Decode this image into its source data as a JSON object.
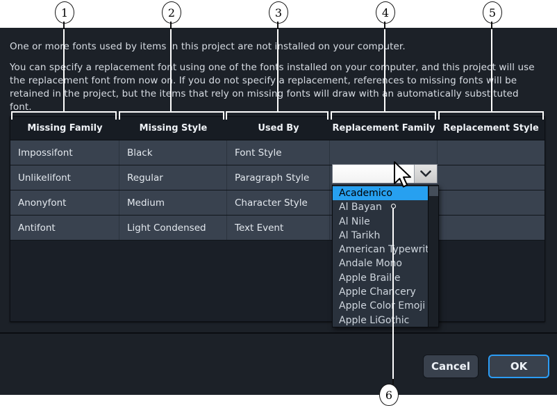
{
  "dialog": {
    "intro_line1": "One or more fonts used by items in this project are not installed on your computer.",
    "intro_line2": "You can specify a replacement font using one of the fonts installed on your computer, and this project will use the replacement font from now on. If you do not specify a replacement, references to missing fonts will be retained in the project, but the items that rely on missing fonts will draw with an automatically substituted font."
  },
  "table": {
    "headers": [
      "Missing Family",
      "Missing Style",
      "Used By",
      "Replacement Family",
      "Replacement Style"
    ],
    "rows": [
      {
        "missing_family": "Impossifont",
        "missing_style": "Black",
        "used_by": "Font Style",
        "replacement_family": "",
        "replacement_style": ""
      },
      {
        "missing_family": "Unlikelifont",
        "missing_style": "Regular",
        "used_by": "Paragraph Style",
        "replacement_family": "",
        "replacement_style": ""
      },
      {
        "missing_family": "Anonyfont",
        "missing_style": "Medium",
        "used_by": "Character Style",
        "replacement_family": "",
        "replacement_style": ""
      },
      {
        "missing_family": "Antifont",
        "missing_style": "Light Condensed",
        "used_by": "Text Event",
        "replacement_family": "",
        "replacement_style": ""
      }
    ]
  },
  "combobox": {
    "value": "",
    "placeholder": "",
    "chevron_icon": "chevron-down-icon"
  },
  "dropdown": {
    "selected": "Academico",
    "options": [
      "Academico",
      "Al Bayan",
      "Al Nile",
      "Al Tarikh",
      "American Typewriter",
      "Andale Mono",
      "Apple Braille",
      "Apple Chancery",
      "Apple Color Emoji",
      "Apple LiGothic"
    ]
  },
  "footer": {
    "cancel_label": "Cancel",
    "ok_label": "OK"
  },
  "callouts": {
    "numbers": [
      "1",
      "2",
      "3",
      "4",
      "5",
      "6"
    ]
  },
  "colors": {
    "dialog_background": "#1c2128",
    "table_row": "#39424f",
    "table_header": "#171c23",
    "highlight_blue": "#27a0f0",
    "ok_border_blue": "#2b9cf5",
    "text_primary": "#e3e8ee",
    "callout_white": "#ffffff"
  }
}
